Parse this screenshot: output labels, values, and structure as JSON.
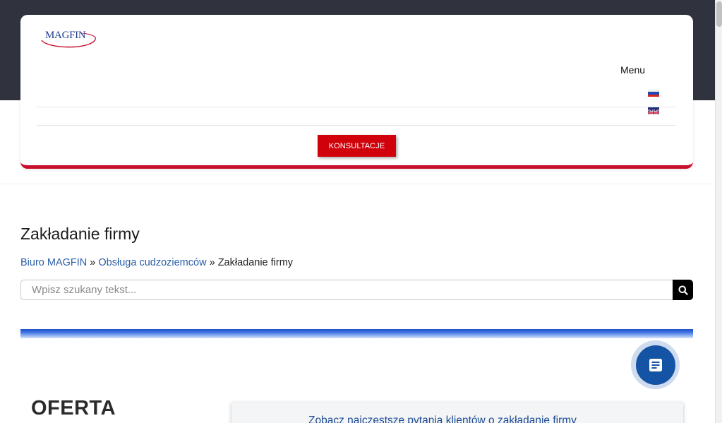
{
  "header": {
    "logo_text": "MAGFIN",
    "menu_label": "Menu",
    "languages": [
      "ru-flag",
      "gb-flag"
    ],
    "cta_label": "KONSULTACJE"
  },
  "main": {
    "page_title": "Zakładanie firmy",
    "breadcrumb": [
      {
        "label": "Biuro MAGFIN",
        "link": true
      },
      {
        "label": "Obsługa cudzoziemców",
        "link": true
      },
      {
        "label": "Zakładanie firmy",
        "link": false
      }
    ],
    "breadcrumb_separator": "»",
    "search": {
      "placeholder": "Wpisz szukany tekst...",
      "value": ""
    },
    "section_title": "OFERTA",
    "faq_link": "Zobacz najczęstsze pytania klientów o zakładanie firmy"
  },
  "colors": {
    "top_band": "#30323d",
    "accent_red": "#c8102e",
    "cta_red": "#d0010b",
    "link_blue": "#2a5fa8",
    "fab_blue": "#1553a5"
  },
  "icons": {
    "search": "search-icon",
    "fab": "document-icon"
  }
}
